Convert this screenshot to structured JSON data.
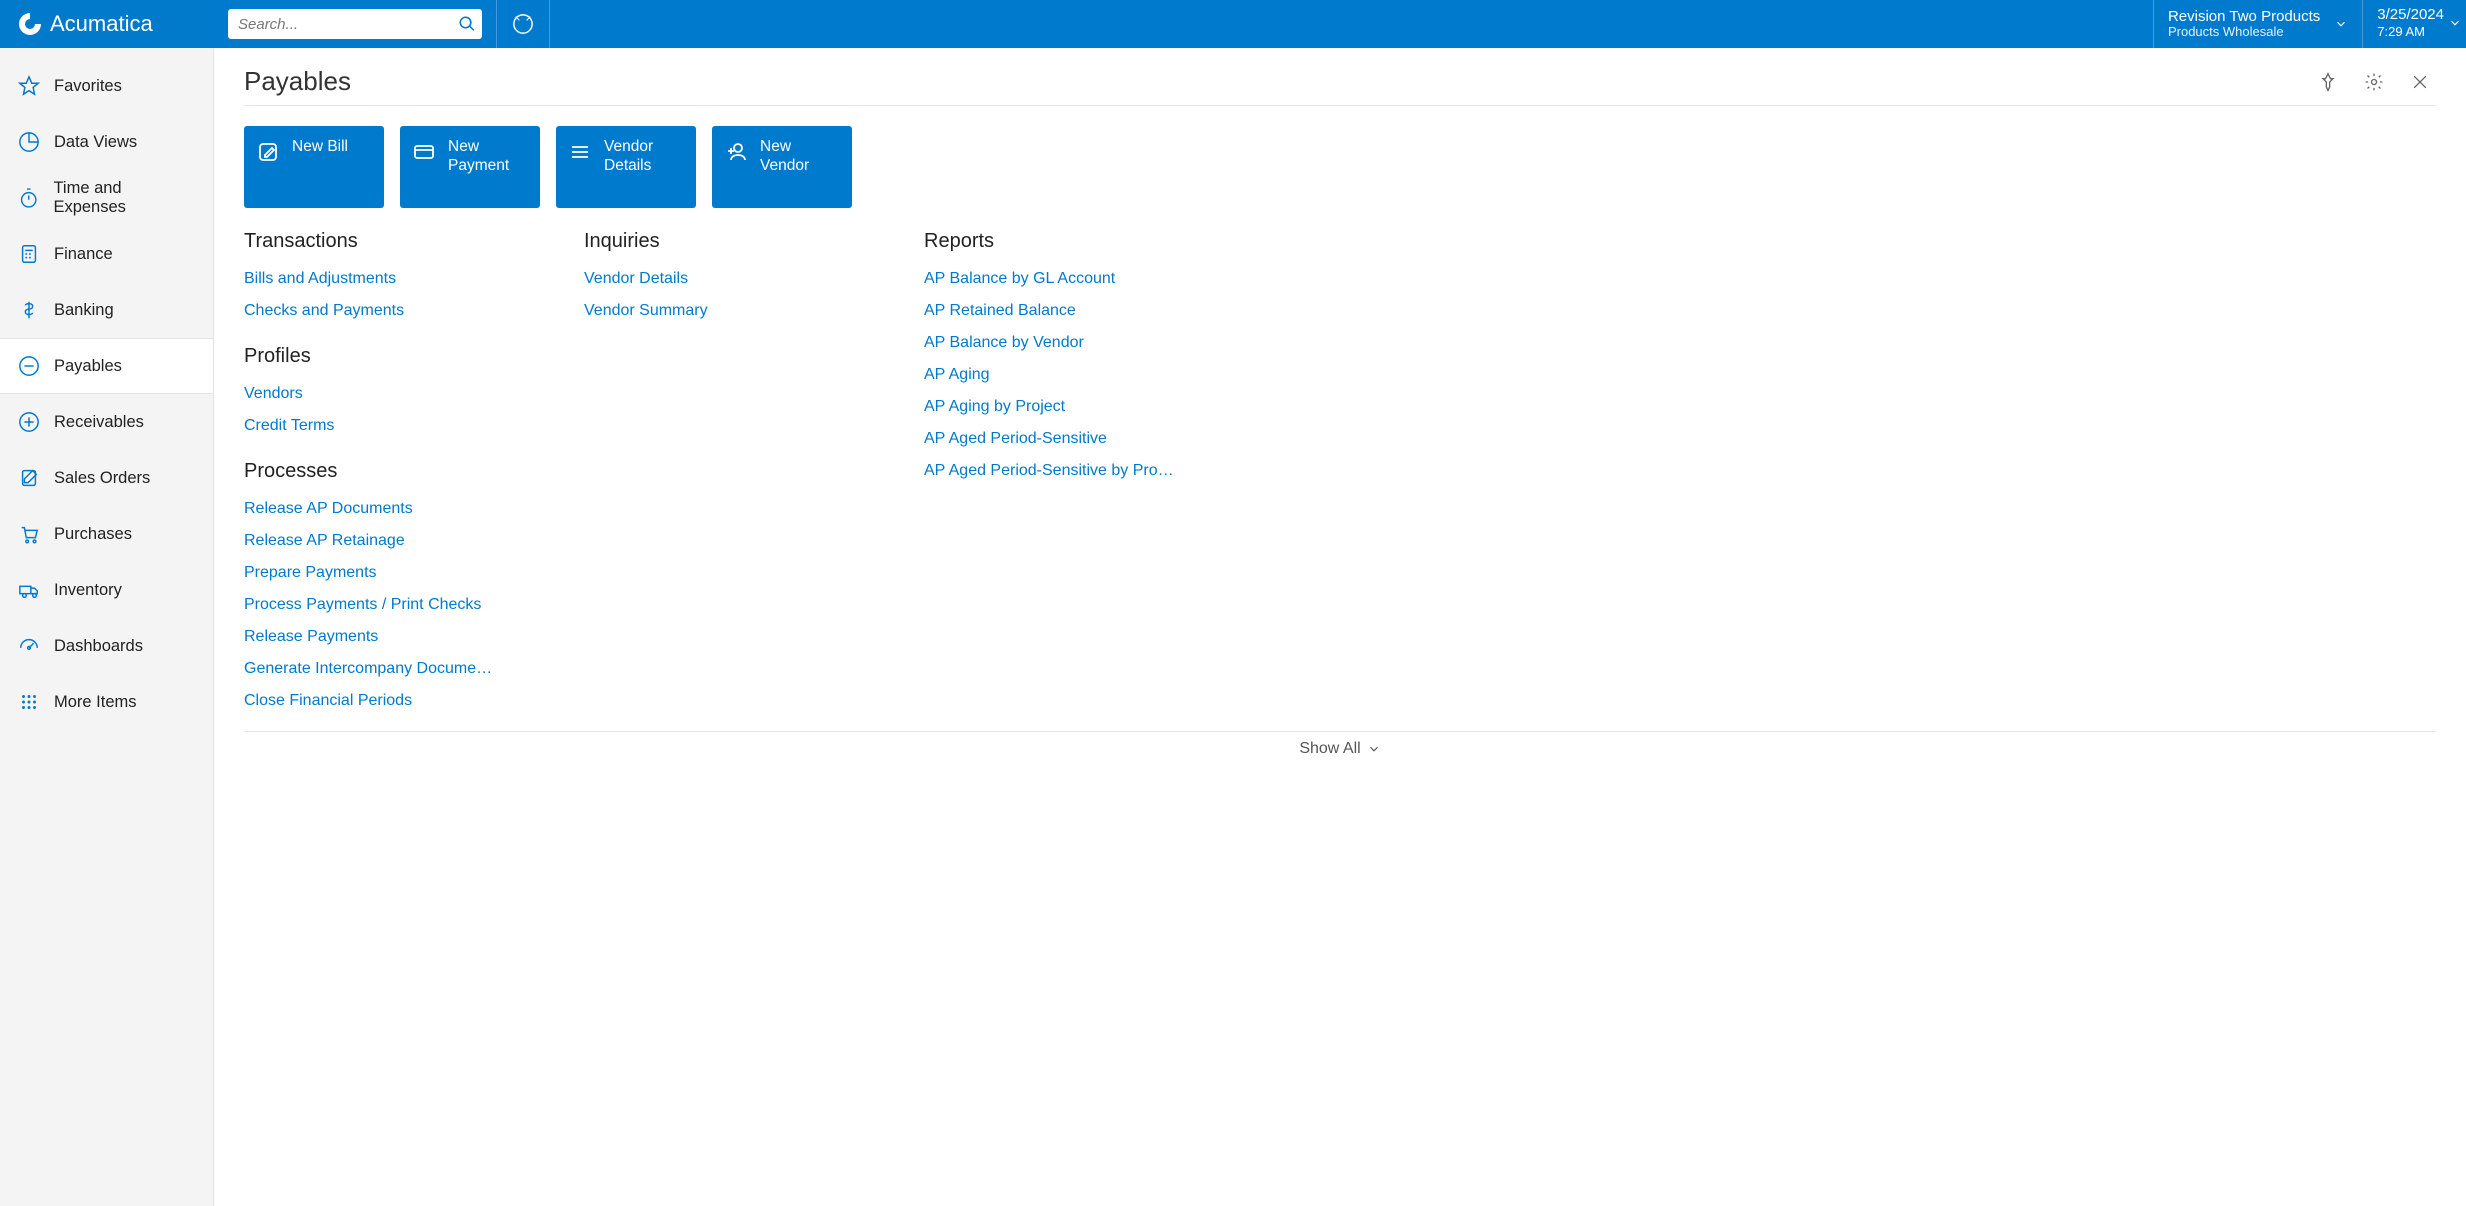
{
  "brand": "Acumatica",
  "search": {
    "placeholder": "Search..."
  },
  "tenant": {
    "name": "Revision Two Products",
    "sub": "Products Wholesale"
  },
  "datetime": {
    "date": "3/25/2024",
    "time": "7:29 AM"
  },
  "sidebar": {
    "items": [
      {
        "label": "Favorites"
      },
      {
        "label": "Data Views"
      },
      {
        "label": "Time and Expenses"
      },
      {
        "label": "Finance"
      },
      {
        "label": "Banking"
      },
      {
        "label": "Payables"
      },
      {
        "label": "Receivables"
      },
      {
        "label": "Sales Orders"
      },
      {
        "label": "Purchases"
      },
      {
        "label": "Inventory"
      },
      {
        "label": "Dashboards"
      },
      {
        "label": "More Items"
      }
    ]
  },
  "page": {
    "title": "Payables"
  },
  "tiles": [
    {
      "label": "New Bill"
    },
    {
      "label": "New Payment"
    },
    {
      "label": "Vendor Details"
    },
    {
      "label": "New Vendor"
    }
  ],
  "columns": [
    {
      "groups": [
        {
          "title": "Transactions",
          "links": [
            "Bills and Adjustments",
            "Checks and Payments"
          ]
        },
        {
          "title": "Profiles",
          "links": [
            "Vendors",
            "Credit Terms"
          ]
        },
        {
          "title": "Processes",
          "links": [
            "Release AP Documents",
            "Release AP Retainage",
            "Prepare Payments",
            "Process Payments / Print Checks",
            "Release Payments",
            "Generate Intercompany Docume…",
            "Close Financial Periods"
          ]
        }
      ]
    },
    {
      "groups": [
        {
          "title": "Inquiries",
          "links": [
            "Vendor Details",
            "Vendor Summary"
          ]
        }
      ]
    },
    {
      "groups": [
        {
          "title": "Reports",
          "links": [
            "AP Balance by GL Account",
            "AP Retained Balance",
            "AP Balance by Vendor",
            "AP Aging",
            "AP Aging by Project",
            "AP Aged Period-Sensitive",
            "AP Aged Period-Sensitive by Pro…"
          ]
        }
      ]
    }
  ],
  "footer": {
    "label": "Show All"
  }
}
